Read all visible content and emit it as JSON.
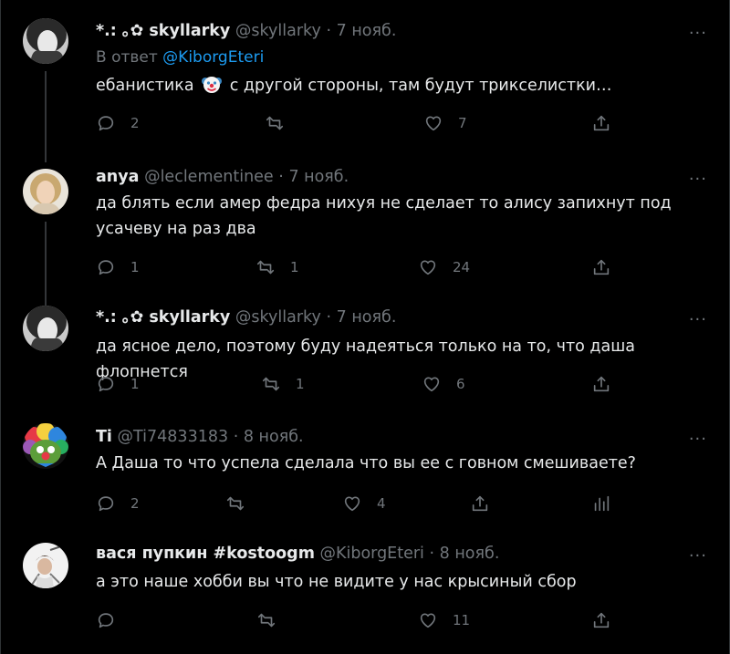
{
  "tweets": [
    {
      "name": "*.: ｡✿ skyllarky",
      "handle": "@skyllarky",
      "sep": "·",
      "date": "7 нояб.",
      "reply_prefix": "В ответ",
      "reply_mention": "@KiborgEteri",
      "text_before": "ебанистика",
      "text_emoji": "clown-face",
      "text_after": "с другой стороны, там будут трикселистки…",
      "reply_count": "2",
      "retweet_count": "",
      "like_count": "7"
    },
    {
      "name": "anya",
      "handle": "@leclementinee",
      "sep": "·",
      "date": "7 нояб.",
      "text": "да блять если амер федра нихуя не сделает то алису запихнут под усачеву на раз два",
      "reply_count": "1",
      "retweet_count": "1",
      "like_count": "24"
    },
    {
      "name": "*.: ｡✿ skyllarky",
      "handle": "@skyllarky",
      "sep": "·",
      "date": "7 нояб.",
      "text": "да ясное дело, поэтому буду надеяться только на то, что даша флопнется",
      "reply_count": "1",
      "retweet_count": "1",
      "like_count": "6"
    },
    {
      "name": "Ti",
      "handle": "@Ti74833183",
      "sep": "·",
      "date": "8 нояб.",
      "text": "А Даша то что успела сделала что вы ее с говном смешиваете?",
      "reply_count": "2",
      "retweet_count": "",
      "like_count": "4"
    },
    {
      "name": "вася пупкин #kostoogm",
      "handle": "@KiborgEteri",
      "sep": "·",
      "date": "8 нояб.",
      "text": "а это наше хобби вы что не видите у нас крысиный сбор",
      "reply_count": "",
      "retweet_count": "",
      "like_count": "11"
    }
  ],
  "more_label": "···",
  "icons": {
    "reply": "reply-icon",
    "retweet": "retweet-icon",
    "like": "heart-icon",
    "share": "share-icon",
    "analytics": "analytics-icon"
  }
}
